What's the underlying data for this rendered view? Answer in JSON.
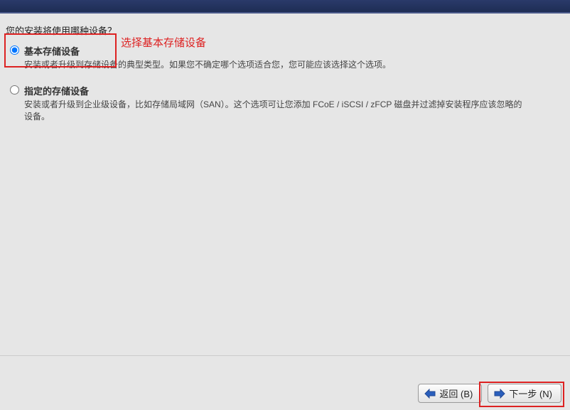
{
  "prompt": "您的安装将使用哪种设备？",
  "annotation": "选择基本存储设备",
  "options": {
    "basic": {
      "title": "基本存储设备",
      "desc": "安装或者升级到存储设备的典型类型。如果您不确定哪个选项适合您，您可能应该选择这个选项。"
    },
    "special": {
      "title": "指定的存储设备",
      "desc": "安装或者升级到企业级设备，比如存储局域网（SAN）。这个选项可让您添加 FCoE / iSCSI / zFCP 磁盘并过滤掉安装程序应该忽略的设备。"
    }
  },
  "buttons": {
    "back": "返回 (B)",
    "next": "下一步 (N)"
  }
}
